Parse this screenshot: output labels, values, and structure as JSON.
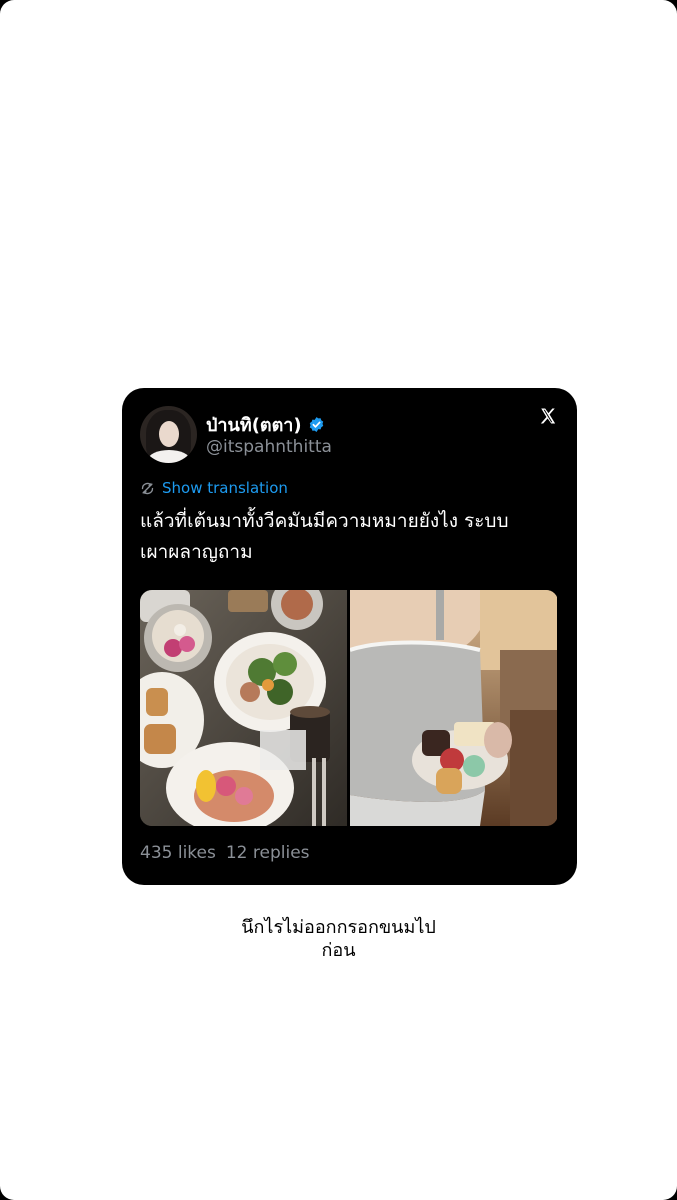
{
  "tweet": {
    "display_name": "ป่านทิ(ตตา)",
    "handle": "@itspahnthitta",
    "translate_label": "Show translation",
    "text_line_1": "แล้วที่เต้นมาทั้งวีคมันมีความหมายยังไง ระบบ",
    "text_line_2": "เผาผลาญถาม",
    "likes": "435 likes",
    "replies": "12 replies",
    "icons": {
      "verified": "verified-badge-icon",
      "logo": "x-logo-icon",
      "translate": "translate-icon"
    }
  },
  "media": {
    "photo_1": "food-table-photo",
    "photo_2": "dessert-plate-photo"
  },
  "caption": {
    "line_1": "นึกไรไม่ออกกรอกขนมไป",
    "line_2": "ก่อน"
  },
  "colors": {
    "card_bg": "#000000",
    "link": "#1d9bf0",
    "secondary_text": "#8b9097",
    "verified": "#1d9bf0"
  }
}
